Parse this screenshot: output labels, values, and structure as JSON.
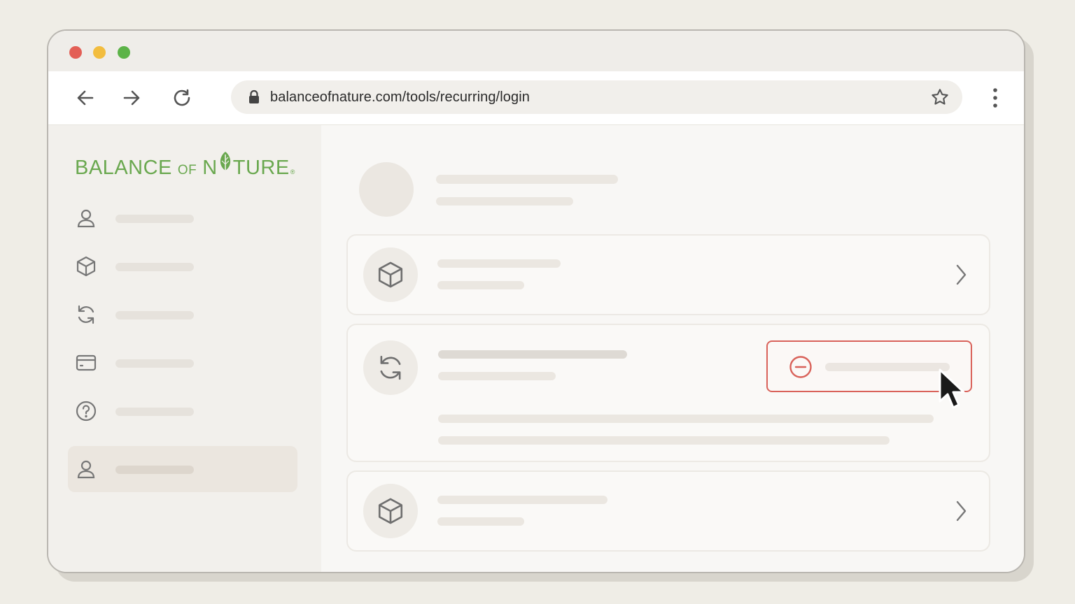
{
  "browser": {
    "window_controls": [
      "close",
      "minimize",
      "maximize"
    ],
    "url": "balanceofnature.com/tools/recurring/login",
    "icons": {
      "back": "arrow-left-icon",
      "forward": "arrow-right-icon",
      "reload": "reload-icon",
      "lock": "lock-icon",
      "bookmark": "star-icon",
      "menu": "kebab-menu-icon"
    }
  },
  "brand": {
    "logo_part1": "BALANCE",
    "logo_part2": "OF",
    "logo_part3a": "N",
    "logo_part3b": "TURE",
    "logo_reg": "®",
    "color": "#6aa84f"
  },
  "sidebar": {
    "items": [
      {
        "icon": "user-icon",
        "active": false
      },
      {
        "icon": "box-icon",
        "active": false
      },
      {
        "icon": "refresh-icon",
        "active": false
      },
      {
        "icon": "card-icon",
        "active": false
      },
      {
        "icon": "help-icon",
        "active": false
      },
      {
        "icon": "user-icon",
        "active": true
      }
    ]
  },
  "main": {
    "cards": [
      {
        "icon": "box-icon",
        "action": "chevron-right-icon"
      },
      {
        "icon": "refresh-icon",
        "action": "cancel-button"
      },
      {
        "icon": "box-icon",
        "action": "chevron-right-icon"
      }
    ],
    "cancel_button_icon": "minus-circle-icon",
    "accent_color": "#d9625a"
  }
}
